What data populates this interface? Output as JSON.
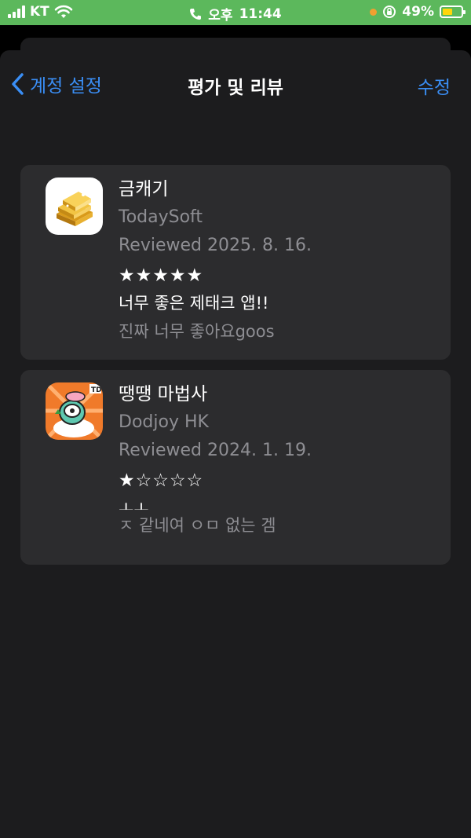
{
  "status_bar": {
    "carrier": "KT",
    "time_prefix": "오후",
    "time": "11:44",
    "battery_percent": "49%",
    "icons": [
      "signal-icon",
      "wifi-icon",
      "phone-icon",
      "orange-dot-icon",
      "rotation-lock-icon",
      "battery-icon"
    ]
  },
  "nav": {
    "back_label": "계정 설정",
    "title": "평가 및 리뷰",
    "edit_label": "수정"
  },
  "reviews": [
    {
      "app_name": "금캐기",
      "developer": "TodaySoft",
      "reviewed": "Reviewed 2025. 8. 16.",
      "stars": "★★★★★",
      "rating": 5,
      "title": "너무 좋은 제태크 앱!!",
      "body": "진짜 너무 좋아요goos",
      "icon": "gold-bars-icon"
    },
    {
      "app_name": "땡땡 마법사",
      "developer": "Dodjoy HK",
      "reviewed": "Reviewed 2024. 1. 19.",
      "stars": "★☆☆☆☆",
      "rating": 1,
      "title": "ㅗㅗ",
      "body": "ㅈ 같네여 ㅇㅁ 없는 겜",
      "icon": "wizard-game-icon"
    }
  ],
  "colors": {
    "accent": "#3a8ef5",
    "status_bar": "#5cb85c",
    "card": "#2c2c2e",
    "secondary_text": "#8e8e93"
  }
}
